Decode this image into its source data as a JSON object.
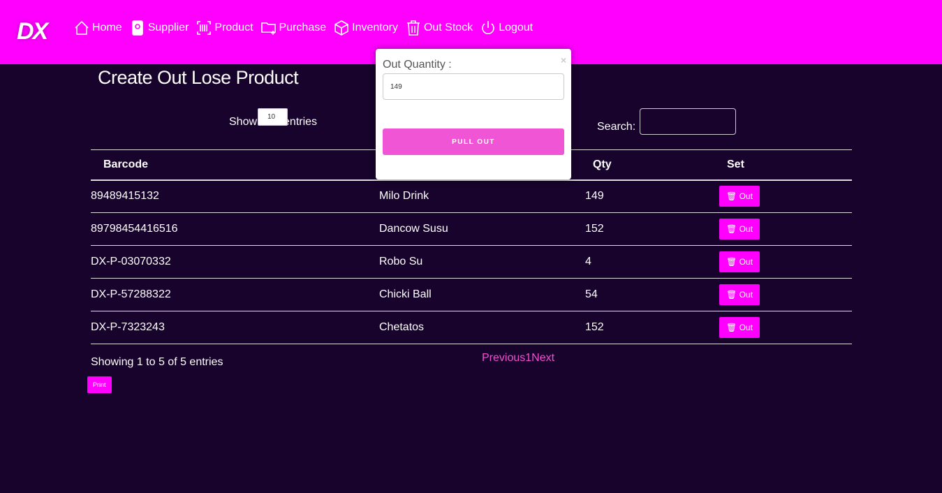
{
  "logo": "DX",
  "nav": [
    {
      "label": "Home",
      "icon": "home-icon"
    },
    {
      "label": "Supplier",
      "icon": "id-badge-icon"
    },
    {
      "label": "Product",
      "icon": "barcode-icon"
    },
    {
      "label": "Purchase",
      "icon": "folder-plus-icon"
    },
    {
      "label": "Inventory",
      "icon": "box-icon"
    },
    {
      "label": "Out Stock",
      "icon": "trash-icon"
    },
    {
      "label": "Logout",
      "icon": "power-icon"
    }
  ],
  "title": "Create Out Lose Product",
  "length": {
    "show": "Show",
    "value": "10",
    "entries": "entries"
  },
  "search_label": "Search:",
  "columns": [
    "Barcode",
    "",
    "Qty",
    "Set"
  ],
  "rows": [
    {
      "barcode": "89489415132",
      "name": "Milo Drink",
      "qty": "149"
    },
    {
      "barcode": "89798454416516",
      "name": "Dancow Susu",
      "qty": "152"
    },
    {
      "barcode": "DX-P-03070332",
      "name": "Robo Su",
      "qty": "4"
    },
    {
      "barcode": "DX-P-57288322",
      "name": "Chicki Ball",
      "qty": "54"
    },
    {
      "barcode": "DX-P-7323243",
      "name": "Chetatos",
      "qty": "152"
    }
  ],
  "out_label": "🗑 Out",
  "info": "Showing 1 to 5 of 5 entries",
  "pagination": {
    "prev": "Previous",
    "page": "1",
    "next": "Next"
  },
  "print": "Print",
  "modal": {
    "label": "Out Quantity :",
    "close": "×",
    "value": "149",
    "button": "PULL OUT"
  },
  "colors": {
    "nav": "#ff00ff",
    "bg": "#17032c",
    "button": "#f055d6"
  }
}
